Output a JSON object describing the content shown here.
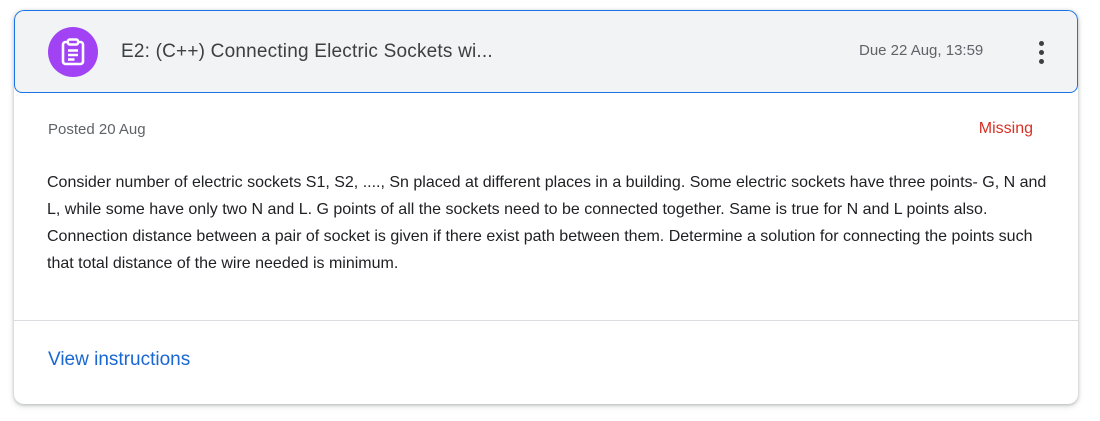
{
  "assignment": {
    "icon": "assignment-icon",
    "title": "E2: (C++) Connecting Electric Sockets wi...",
    "due": "Due 22 Aug, 13:59",
    "more_icon": "more-vert-icon",
    "posted": "Posted 20 Aug",
    "status": "Missing",
    "description": "Consider number of electric sockets S1, S2, ...., Sn placed at different places in a building. Some electric sockets have three points- G, N and L, while some have only two N and L. G points of all the sockets need to be connected together. Same is true for N and L points also. Connection distance between a pair of socket is given if there exist path between them. Determine a solution for connecting the points such that total distance of the wire needed is minimum.",
    "view_instructions": "View instructions"
  },
  "colors": {
    "icon_background": "#a142f4",
    "header_border": "#1a73e8",
    "header_background": "#f1f3f4",
    "missing": "#d93025",
    "link": "#1967d2"
  }
}
